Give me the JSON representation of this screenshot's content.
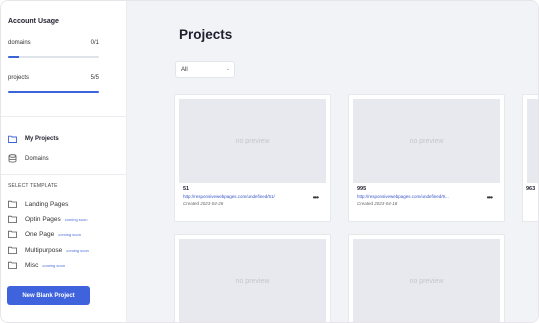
{
  "sidebar": {
    "usage_title": "Account Usage",
    "usage": [
      {
        "label": "domains",
        "value": "0/1",
        "fill": 0.12
      },
      {
        "label": "projects",
        "value": "5/5",
        "fill": 1.0
      }
    ],
    "nav": [
      {
        "label": "My Projects",
        "icon": "folder-icon"
      },
      {
        "label": "Domains",
        "icon": "database-icon"
      }
    ],
    "section_title": "SELECT TEMPLATE",
    "templates": [
      {
        "label": "Landing Pages",
        "badge": ""
      },
      {
        "label": "Optin Pages",
        "badge": "coming soon"
      },
      {
        "label": "One Page",
        "badge": "coming soon"
      },
      {
        "label": "Multipurpose",
        "badge": "coming soon"
      },
      {
        "label": "Misc",
        "badge": "coming soon"
      }
    ],
    "new_button": "New Blank Project"
  },
  "main": {
    "title": "Projects",
    "filter": {
      "value": "All"
    },
    "preview_text": "no preview",
    "cards": [
      {
        "name": "51",
        "url": "http://responsivewebpages.com/undefined/51/",
        "created": "Created 2023-04-26"
      },
      {
        "name": "995",
        "url": "http://responsivewebpages.com/undefined/9...",
        "created": "Created 2023-04-18"
      },
      {
        "name": "963",
        "url": "",
        "created": ""
      },
      {
        "name": "",
        "url": "",
        "created": ""
      },
      {
        "name": "",
        "url": "",
        "created": ""
      }
    ]
  },
  "colors": {
    "accent": "#3e63dd",
    "bar_fill": "#3a64d8",
    "main_bg": "#f2f3f6"
  }
}
